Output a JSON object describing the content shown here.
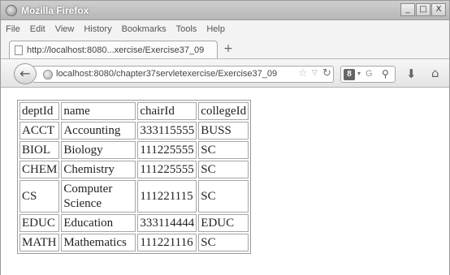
{
  "window": {
    "title": "Mozilla Firefox",
    "controls": {
      "minimize": "_",
      "maximize": "□",
      "close": "X"
    }
  },
  "menubar": {
    "items": [
      "File",
      "Edit",
      "View",
      "History",
      "Bookmarks",
      "Tools",
      "Help"
    ]
  },
  "tab": {
    "label": "http://localhost:8080...xercise/Exercise37_09",
    "newtab_symbol": "+"
  },
  "navbar": {
    "url": "localhost:8080/chapter37servletexercise/Exercise37_09",
    "search": {
      "engine_glyph": "8",
      "placeholder": "G"
    },
    "icons": [
      "back-icon",
      "globe-icon",
      "star-icon",
      "reload-icon",
      "search-icon",
      "download-icon",
      "home-icon"
    ]
  },
  "table": {
    "headers": [
      "deptId",
      "name",
      "chairId",
      "collegeId"
    ],
    "rows": [
      [
        "ACCT",
        "Accounting",
        "333115555",
        "BUSS"
      ],
      [
        "BIOL",
        "Biology",
        "111225555",
        "SC"
      ],
      [
        "CHEM",
        "Chemistry",
        "111225555",
        "SC"
      ],
      [
        "CS",
        "Computer Science",
        "111221115",
        "SC"
      ],
      [
        "EDUC",
        "Education",
        "333114444",
        "EDUC"
      ],
      [
        "MATH",
        "Mathematics",
        "111221116",
        "SC"
      ]
    ]
  }
}
